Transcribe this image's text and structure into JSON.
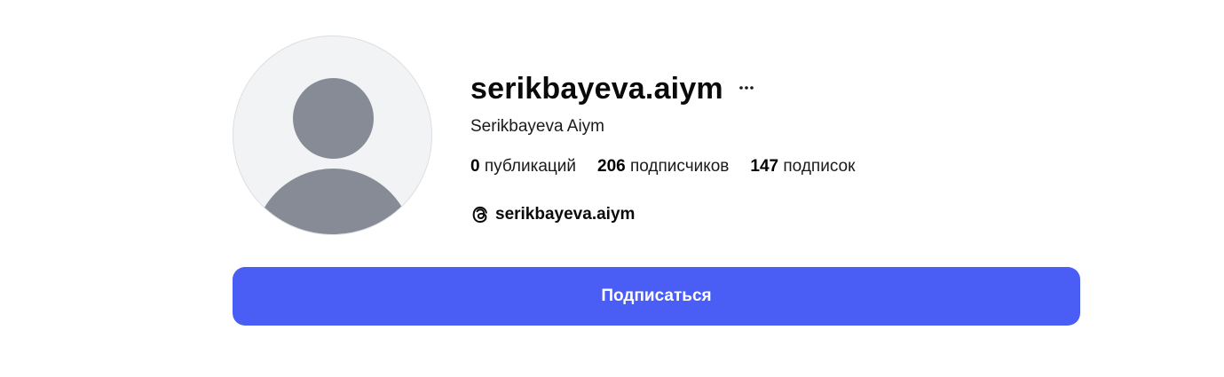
{
  "profile": {
    "username": "serikbayeva.aiym",
    "full_name": "Serikbayeva Aiym",
    "more_icon": "more-horizontal-icon",
    "avatar_icon": "default-avatar-icon",
    "stats": {
      "posts_count": "0",
      "posts_label": "публикаций",
      "followers_count": "206",
      "followers_label": "подписчиков",
      "following_count": "147",
      "following_label": "подписок"
    },
    "threads": {
      "icon": "threads-icon",
      "handle": "serikbayeva.aiym"
    }
  },
  "actions": {
    "follow_label": "Подписаться"
  },
  "colors": {
    "button_bg": "#4a5ef6",
    "button_text": "#ffffff",
    "avatar_bg": "#f2f3f5",
    "avatar_silhouette": "#868b96"
  }
}
